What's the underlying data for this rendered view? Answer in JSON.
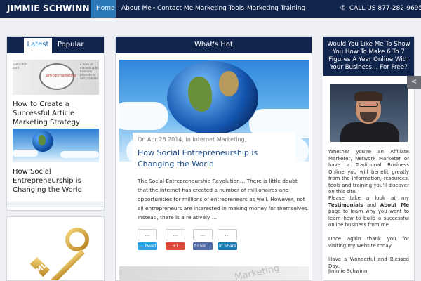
{
  "header": {
    "brand": "JIMMIE SCHWINN",
    "nav": [
      {
        "label": "Home"
      },
      {
        "label": "About Me"
      },
      {
        "label": "Contact Me"
      },
      {
        "label": "Marketing Tools"
      },
      {
        "label": "Marketing Training"
      }
    ],
    "about_caret": "▾",
    "phone": "CALL US 877-282-9695",
    "phone_icon": "phone-icon"
  },
  "left": {
    "tabs": [
      "Latest",
      "Popular"
    ],
    "posts": [
      {
        "title": "How to Create a Successful Article Marketing Strategy",
        "image": "article-marketing-magnifier"
      },
      {
        "title": "How Social Entrepreneurship is Changing the World",
        "image": "globe-clouds"
      }
    ],
    "image1_text": "article marketing",
    "image1_paper_left": "computers such",
    "image1_paper_right": "a form of marketing by business promote or sell products",
    "key_label": "MLM"
  },
  "center": {
    "header": "What's Hot",
    "post": {
      "meta": "On Apr 26 2014, In Internet Marketing,",
      "title": "How Social Entrepreneurship is Changing the World",
      "excerpt": "The Social Entrepreneurship Revolution… There is little doubt that the internet has created a number of millionaires and opportunities for millions of entrepreneurs as well. However, not all entrepreneurs are interested in making money for themselves. Instead, there is a relatively …"
    },
    "share": [
      {
        "count": "...",
        "label": "Tweet",
        "color": "#2b9ee6"
      },
      {
        "count": "...",
        "label": "+1",
        "color": "#d84b38"
      },
      {
        "count": "...",
        "label": "Like",
        "color": "#4f6aa8"
      },
      {
        "count": "...",
        "label": "Share",
        "color": "#1b7cb5"
      }
    ],
    "next_image_text": "Marketing"
  },
  "right": {
    "header": "Would You Like Me To Show You How To Make 6 To 7 Figures A Year Online With Your Business… For Free?",
    "text1": "Whether you're an Affiliate Marketer, Network Marketer or have a Traditional Business Online you will benefit greatly from the information, resources, tools and training you'll discover on this site.",
    "text2_prefix": "Please take a look at my",
    "text2_link1": "Testimonials",
    "text2_mid": "and",
    "text2_link2": "About Me",
    "text2_suffix": "page to learn why you want to learn how to build a successful online business from me.",
    "text3": "Once again thank you for visiting my website today.",
    "text4": "Have a Wonderful and Blessed Day,",
    "text5": "Jimmie Schwinn",
    "side_share_icon": "share-icon"
  },
  "colors": {
    "header_bg": "#12254d",
    "accent": "#2a78b8",
    "link": "#1a4a88"
  }
}
